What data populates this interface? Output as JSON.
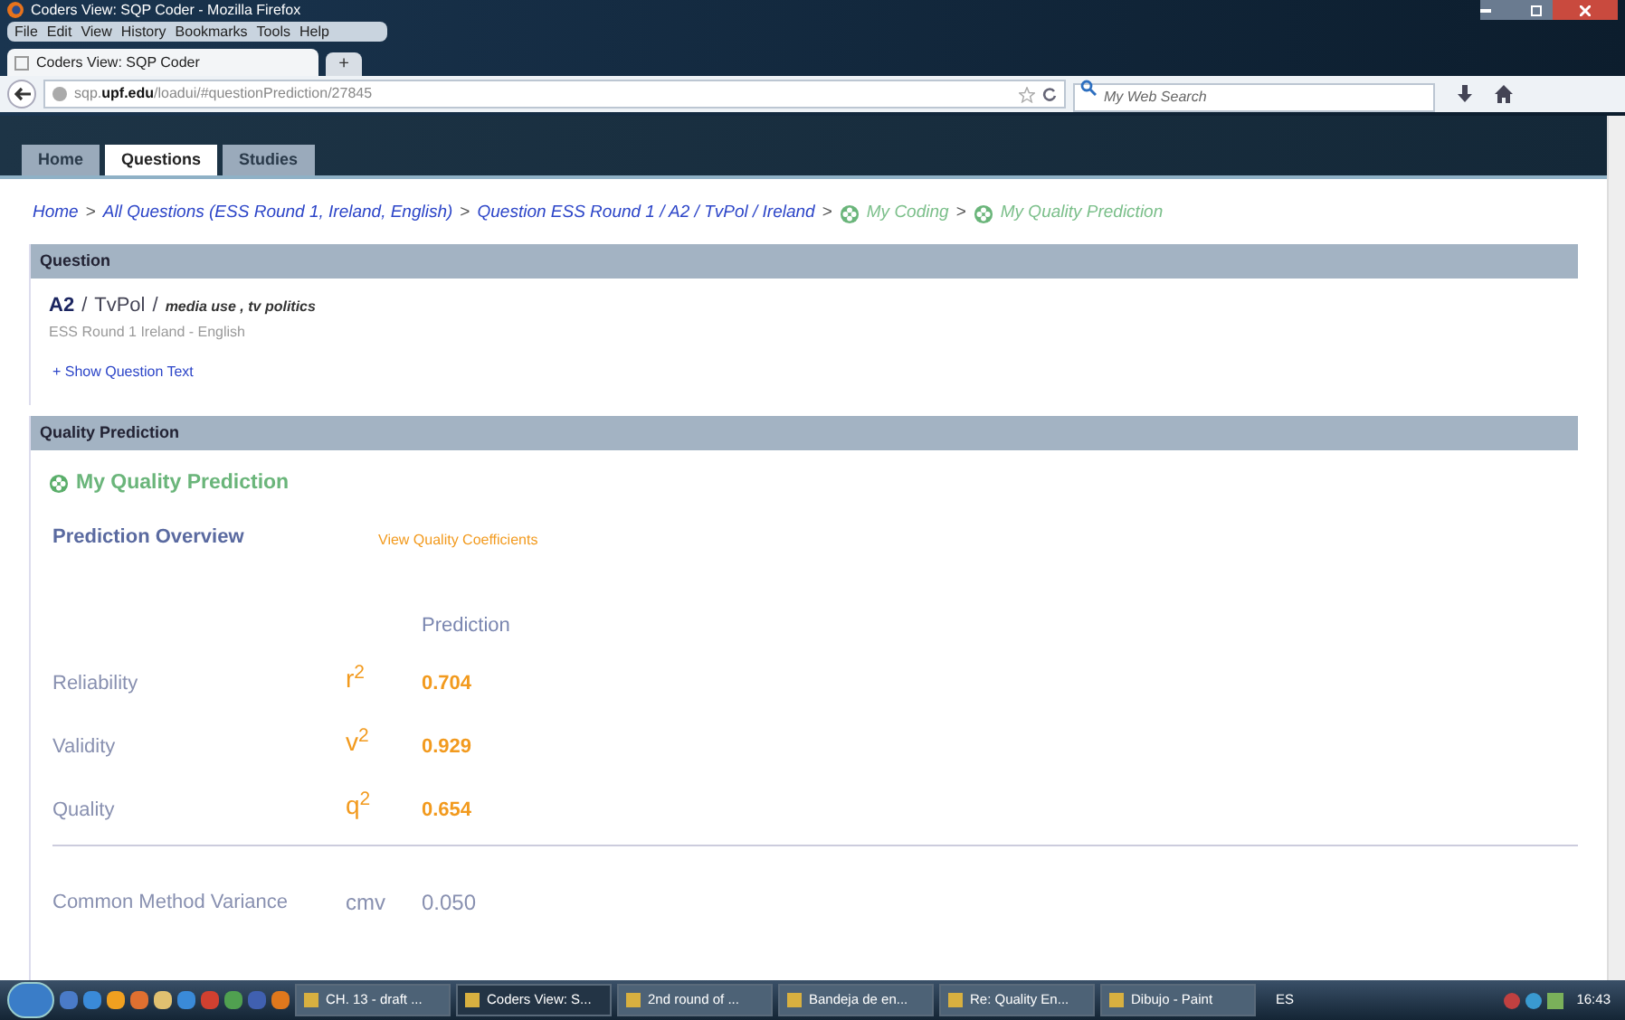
{
  "window": {
    "title": "Coders View: SQP Coder - Mozilla Firefox"
  },
  "menu": [
    "File",
    "Edit",
    "View",
    "History",
    "Bookmarks",
    "Tools",
    "Help"
  ],
  "browser_tab": {
    "title": "Coders View: SQP Coder",
    "new_tab": "+"
  },
  "address_bar": {
    "url": "sqp.**upf.edu**/loadui/#questionPrediction/27845"
  },
  "search": {
    "placeholder": "My Web Search"
  },
  "site_tabs": [
    {
      "label": "Home",
      "selected": false
    },
    {
      "label": "Questions",
      "selected": true
    },
    {
      "label": "Studies",
      "selected": false
    }
  ],
  "breadcrumb": {
    "separator": ">",
    "items": [
      {
        "kind": "link",
        "label": "Home"
      },
      {
        "kind": "link",
        "label": "All Questions (ESS Round 1, Ireland, English)"
      },
      {
        "kind": "link",
        "label": "Question ESS Round 1 / A2 / TvPol / Ireland"
      },
      {
        "kind": "step",
        "label": "My Coding"
      },
      {
        "kind": "step",
        "label": "My Quality Prediction"
      }
    ]
  },
  "question": {
    "header": "Question",
    "code": "A2",
    "separator": "/",
    "name": "TvPol",
    "topics": "media use , tv politics",
    "subtitle": "ESS Round 1 Ireland - English",
    "toggle": "+ Show Question Text"
  },
  "quality": {
    "header": "Quality Prediction",
    "title": "My Quality Prediction",
    "overview": "Prediction Overview",
    "coefficients_link": "View Quality Coefficients",
    "column": "Prediction",
    "rows": [
      {
        "label": "Reliability",
        "symbol": "r$^{2}$",
        "value": "0.704"
      },
      {
        "label": "Validity",
        "symbol": "v$^{2}$",
        "value": "0.929"
      },
      {
        "label": "Quality",
        "symbol": "q$^{2}$",
        "value": "0.654"
      }
    ],
    "cmv": {
      "label": "Common Method Variance",
      "symbol": "cmv",
      "value": "0.050"
    }
  },
  "taskbar": {
    "windows": [
      {
        "label": "CH. 13 - draft ...",
        "selected": false
      },
      {
        "label": "Coders View: S...",
        "selected": true
      },
      {
        "label": "2nd round of ...",
        "selected": false
      },
      {
        "label": "Bandeja de en...",
        "selected": false
      },
      {
        "label": "Re: Quality En...",
        "selected": false
      },
      {
        "label": "Dibujo - Paint",
        "selected": false
      }
    ],
    "language": "ES",
    "time": "16:43"
  }
}
